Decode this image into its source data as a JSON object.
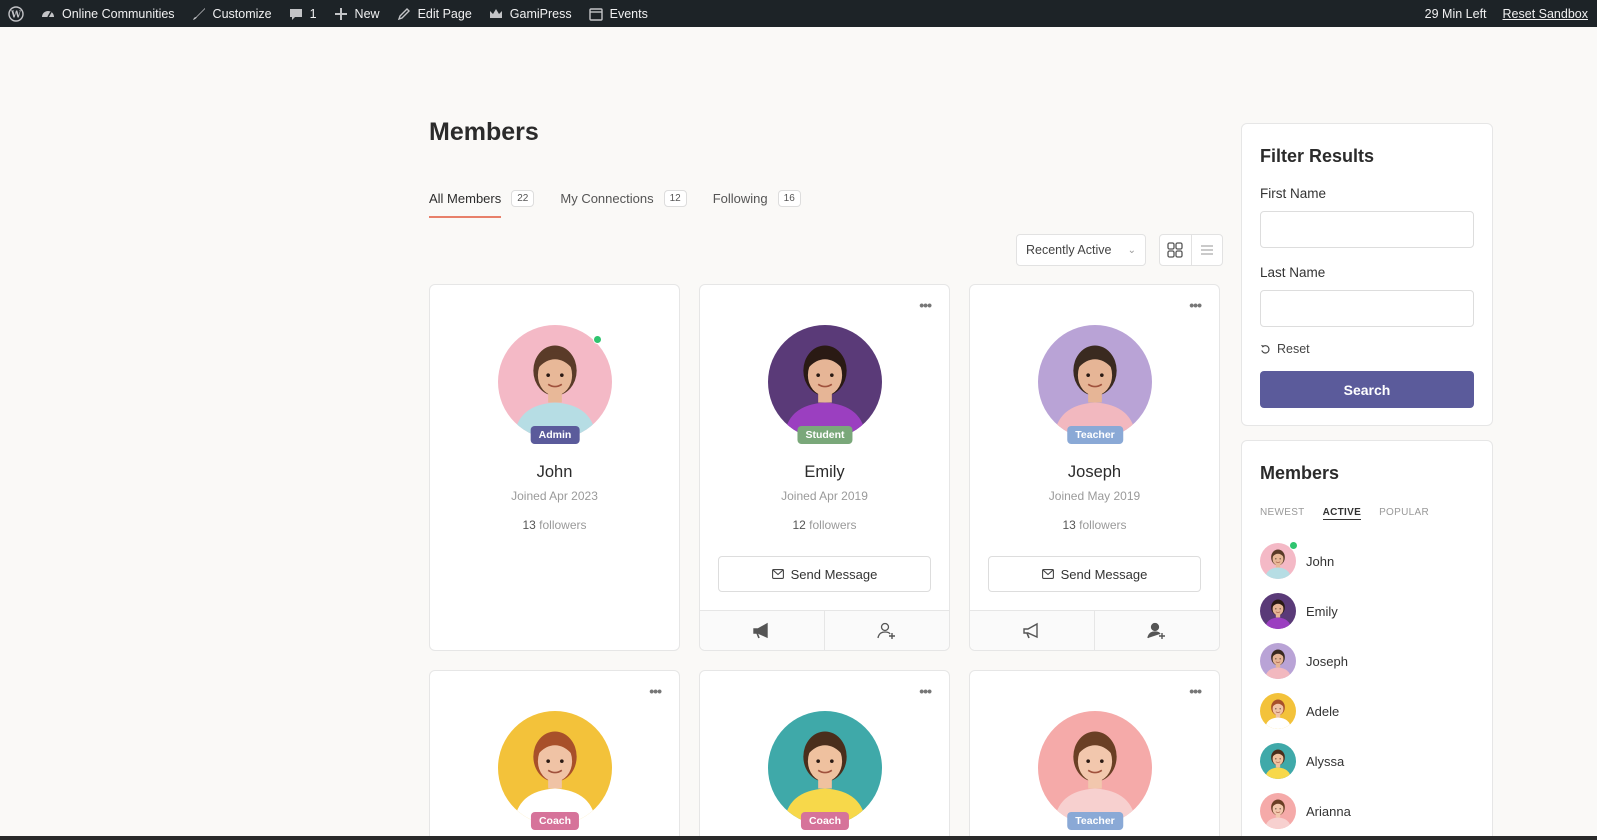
{
  "adminbar": {
    "items": [
      {
        "label": "",
        "icon": "wordpress-icon"
      },
      {
        "label": "Online Communities",
        "icon": "dashboard-icon"
      },
      {
        "label": "Customize",
        "icon": "brush-icon"
      },
      {
        "label": "1",
        "icon": "comment-icon"
      },
      {
        "label": "New",
        "icon": "plus-icon"
      },
      {
        "label": "Edit Page",
        "icon": "pencil-icon"
      },
      {
        "label": "GamiPress",
        "icon": "crown-icon"
      },
      {
        "label": "Events",
        "icon": "calendar-icon"
      }
    ],
    "time_left": "29 Min Left",
    "reset_sandbox": "Reset Sandbox"
  },
  "page": {
    "title": "Members",
    "tabs": [
      {
        "label": "All Members",
        "count": "22"
      },
      {
        "label": "My Connections",
        "count": "12"
      },
      {
        "label": "Following",
        "count": "16"
      }
    ],
    "sort": {
      "value": "Recently Active"
    }
  },
  "members": [
    {
      "name": "John",
      "role": "Admin",
      "role_color": "#5b5b9b",
      "joined": "Joined Apr 2023",
      "followers_count": "13",
      "followers_label": "followers",
      "bg": "#f4b9c6",
      "skin": "#e8b898",
      "shirt": "#b6dde4",
      "hair": "#5a3b28"
    },
    {
      "name": "Emily",
      "role": "Student",
      "role_color": "#7aa87a",
      "joined": "Joined Apr 2019",
      "followers_count": "12",
      "followers_label": "followers",
      "send": "Send Message",
      "bg": "#5a3a78",
      "skin": "#e6b596",
      "shirt": "#9b3fc0",
      "hair": "#2a1a14"
    },
    {
      "name": "Joseph",
      "role": "Teacher",
      "role_color": "#8aa9d6",
      "joined": "Joined May 2019",
      "followers_count": "13",
      "followers_label": "followers",
      "send": "Send Message",
      "bg": "#b9a3d6",
      "skin": "#e6b596",
      "shirt": "#f2b8bf",
      "hair": "#3a2a20"
    },
    {
      "name": "Adele",
      "role": "Coach",
      "role_color": "#d6739a",
      "bg": "#f3c23a",
      "skin": "#f0c3a5",
      "shirt": "#ffffff",
      "hair": "#a8502a"
    },
    {
      "name": "Alyssa",
      "role": "Coach",
      "role_color": "#d6739a",
      "bg": "#3fa9a9",
      "skin": "#efc19f",
      "shirt": "#f7d84a",
      "hair": "#4a2e1c"
    },
    {
      "name": "Arianna",
      "role": "Teacher",
      "role_color": "#8aa9d6",
      "bg": "#f5aaa9",
      "skin": "#f2c7ad",
      "shirt": "#f7d0cf",
      "hair": "#6a3f25"
    }
  ],
  "filter": {
    "title": "Filter Results",
    "first_name": "First Name",
    "last_name": "Last Name",
    "reset": "Reset",
    "search": "Search"
  },
  "members_widget": {
    "title": "Members",
    "tabs": [
      "NEWEST",
      "ACTIVE",
      "POPULAR"
    ]
  }
}
